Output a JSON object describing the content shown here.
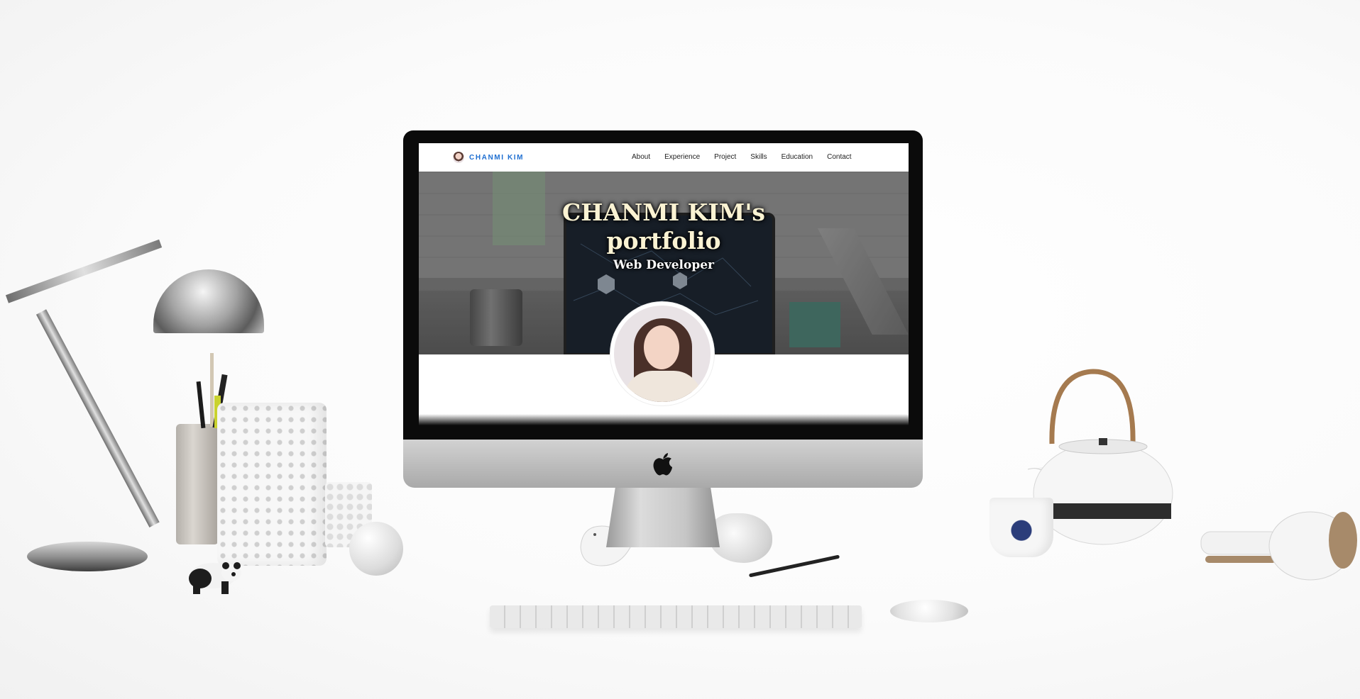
{
  "site": {
    "brand_name": "CHANMI KIM",
    "nav": [
      {
        "label": "About"
      },
      {
        "label": "Experience"
      },
      {
        "label": "Project"
      },
      {
        "label": "Skills"
      },
      {
        "label": "Education"
      },
      {
        "label": "Contact"
      }
    ],
    "hero": {
      "title_line1": "CHANMI KIM's",
      "title_line2": "portfolio",
      "subtitle": "Web Developer"
    }
  },
  "icons": {
    "brand_logo": "avatar-icon",
    "chin_logo": "apple-logo-icon"
  },
  "colors": {
    "brand_text": "#1f6fd1",
    "hero_title": "#fbf3d3",
    "bezel": "#0b0b0b"
  }
}
